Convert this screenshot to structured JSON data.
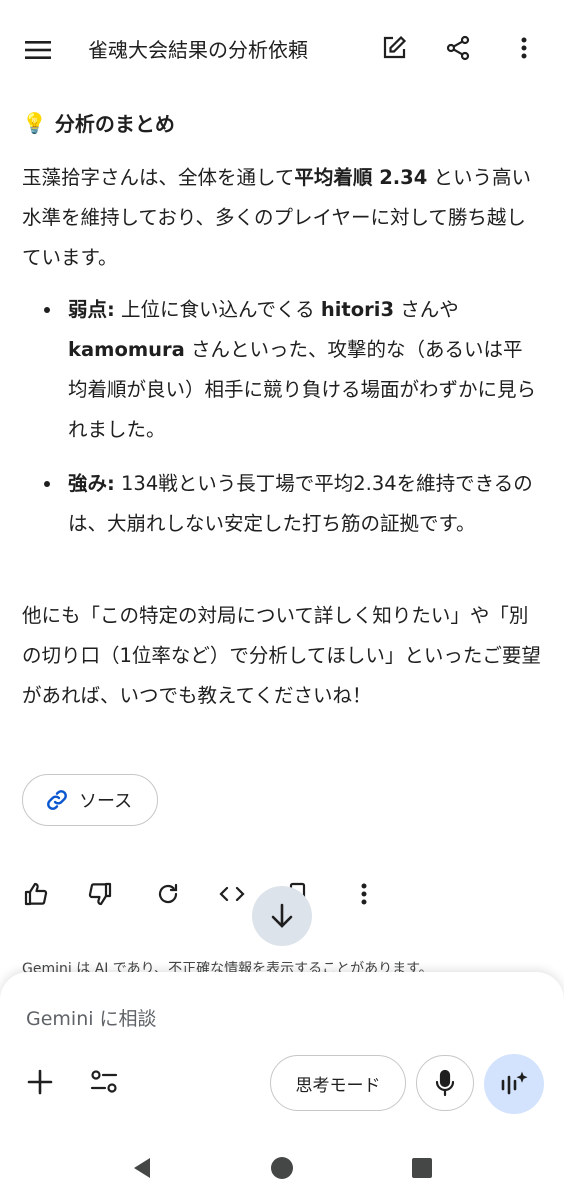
{
  "header": {
    "title": "雀魂大会結果の分析依頼",
    "menu_icon": "hamburger-menu-icon",
    "edit_icon": "edit-icon",
    "share_icon": "share-icon",
    "more_icon": "more-vert-icon"
  },
  "summary": {
    "heading_icon": "💡",
    "heading": "分析のまとめ",
    "intro_pre": "玉藻拾字さんは、全体を通して",
    "intro_bold": "平均着順 2.34",
    "intro_post": " という高い水準を維持しており、多くのプレイヤーに対して勝ち越しています。",
    "bullets": [
      {
        "label": "弱点:",
        "parts": [
          " 上位に食い込んでくる ",
          "hitori3",
          " さんや ",
          "kamomura",
          " さんといった、攻撃的な（あるいは平均着順が良い）相手に競り負ける場面がわずかに見られました。"
        ]
      },
      {
        "label": "強み:",
        "parts": [
          " 134戦という長丁場で平均2.34を維持できるのは、大崩れしない安定した打ち筋の証拠です。"
        ]
      }
    ],
    "closing": "他にも「この特定の対局について詳しく知りたい」や「別の切り口（1位率など）で分析してほしい」といったご要望があれば、いつでも教えてくださいね！"
  },
  "source_chip": {
    "label": "ソース",
    "icon": "link-icon"
  },
  "actions": [
    "thumbs-up-icon",
    "thumbs-down-icon",
    "regenerate-icon",
    "code-icon",
    "copy-icon",
    "more-vert-icon"
  ],
  "disclaimer": "Gemini は AI であり、不正確な情報を表示することがあります。",
  "composer": {
    "placeholder": "Gemini に相談",
    "think_mode_label": "思考モード"
  },
  "colors": {
    "accent": "#0b57d0",
    "chip_bg": "#d3e3fd",
    "scroll_btn_bg": "#dde3ea"
  }
}
